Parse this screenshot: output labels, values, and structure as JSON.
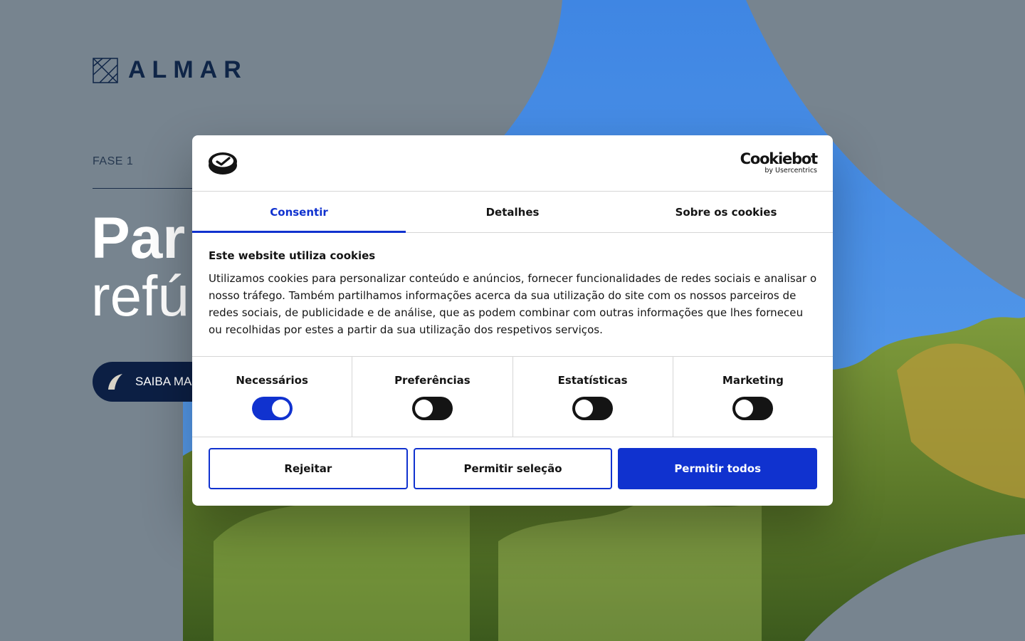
{
  "page": {
    "brand": "ALMAR",
    "phase": "FASE 1",
    "hero_line1": "Par",
    "hero_line2": "refú",
    "cta_label": "SAIBA MAIS"
  },
  "dialog": {
    "provider_logo": "Cookiebot",
    "provider_sub": "by Usercentrics",
    "tabs": [
      {
        "label": "Consentir",
        "active": true
      },
      {
        "label": "Detalhes",
        "active": false
      },
      {
        "label": "Sobre os cookies",
        "active": false
      }
    ],
    "heading": "Este website utiliza cookies",
    "body": "Utilizamos cookies para personalizar conteúdo e anúncios, fornecer funcionalidades de redes sociais e analisar o nosso tráfego. Também partilhamos informações acerca da sua utilização do site com os nossos parceiros de redes sociais, de publicidade e de análise, que as podem combinar com outras informações que lhes forneceu ou recolhidas por estes a partir da sua utilização dos respetivos serviços.",
    "toggles": [
      {
        "label": "Necessários",
        "on": true
      },
      {
        "label": "Preferências",
        "on": false
      },
      {
        "label": "Estatísticas",
        "on": false
      },
      {
        "label": "Marketing",
        "on": false
      }
    ],
    "buttons": {
      "reject": "Rejeitar",
      "allow_selection": "Permitir seleção",
      "allow_all": "Permitir todos"
    }
  },
  "colors": {
    "accent": "#1032cf",
    "navy": "#0c1f44",
    "page_bg": "#77848f",
    "sky": "#4387e0"
  },
  "icons": [
    "almar-logo-icon",
    "cookiebot-mark-icon",
    "leaf-icon"
  ]
}
